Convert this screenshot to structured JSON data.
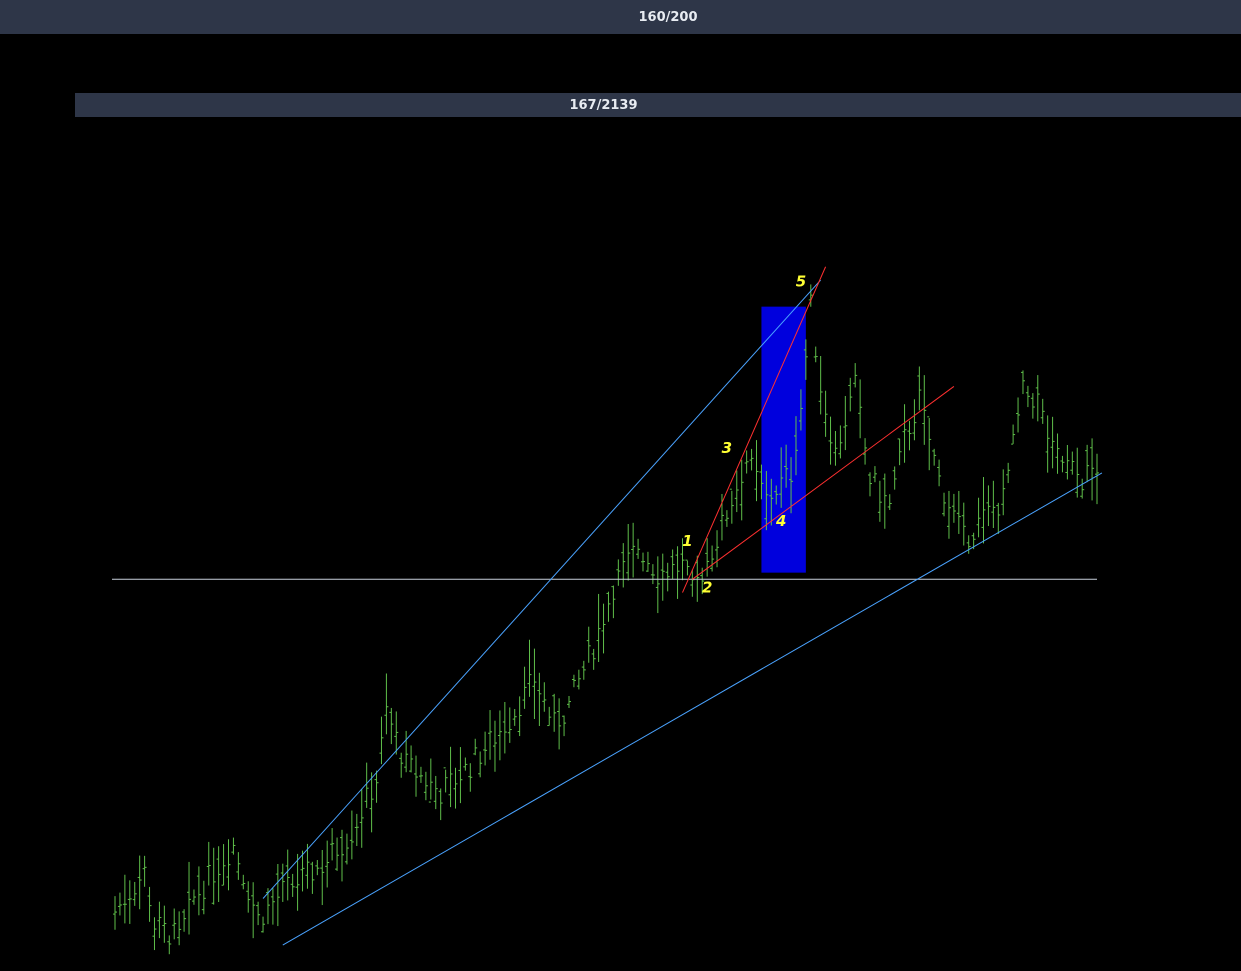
{
  "header": {
    "counter": "160/200"
  },
  "chart_header": {
    "counter": "167/2139"
  },
  "colors": {
    "background": "#000000",
    "bar": "#5fbf4a",
    "trendline_blue": "#4aa3ff",
    "trendline_red": "#ff3030",
    "highlight_box": "#0000dd",
    "horizontal_line": "#c8d0dc",
    "wave_label": "#ffff33",
    "header_bg": "#2e3648"
  },
  "chart_data": {
    "type": "ohlc-bar",
    "grid": false,
    "description_of_series": "price bars",
    "ylim": [
      0,
      100
    ],
    "n_bars": 200,
    "waypoints": [
      [
        0,
        8
      ],
      [
        6,
        14
      ],
      [
        8,
        6
      ],
      [
        13,
        4
      ],
      [
        16,
        10
      ],
      [
        24,
        18
      ],
      [
        29,
        7
      ],
      [
        34,
        11
      ],
      [
        42,
        15
      ],
      [
        48,
        20
      ],
      [
        53,
        28
      ],
      [
        55,
        38
      ],
      [
        59,
        30
      ],
      [
        66,
        26
      ],
      [
        72,
        30
      ],
      [
        80,
        37
      ],
      [
        85,
        43
      ],
      [
        89,
        36
      ],
      [
        92,
        39
      ],
      [
        97,
        48
      ],
      [
        101,
        57
      ],
      [
        106,
        63
      ],
      [
        110,
        59
      ],
      [
        115,
        60
      ],
      [
        117,
        56
      ],
      [
        122,
        64
      ],
      [
        128,
        76
      ],
      [
        132,
        70
      ],
      [
        137,
        74
      ],
      [
        139,
        84
      ],
      [
        141,
        99
      ],
      [
        143,
        87
      ],
      [
        146,
        77
      ],
      [
        150,
        87
      ],
      [
        153,
        73
      ],
      [
        157,
        69
      ],
      [
        160,
        79
      ],
      [
        163,
        85
      ],
      [
        167,
        73
      ],
      [
        172,
        64
      ],
      [
        177,
        68
      ],
      [
        180,
        70
      ],
      [
        184,
        86
      ],
      [
        187,
        85
      ],
      [
        190,
        77
      ],
      [
        196,
        73
      ],
      [
        199,
        75
      ]
    ],
    "annotations": {
      "wave_labels": [
        {
          "label": "1",
          "bar": 116,
          "value": 63
        },
        {
          "label": "2",
          "bar": 120,
          "value": 56
        },
        {
          "label": "3",
          "bar": 124,
          "value": 77
        },
        {
          "label": "4",
          "bar": 135,
          "value": 66
        },
        {
          "label": "5",
          "bar": 139,
          "value": 102
        }
      ],
      "horizontal_line_value": 58
    }
  }
}
